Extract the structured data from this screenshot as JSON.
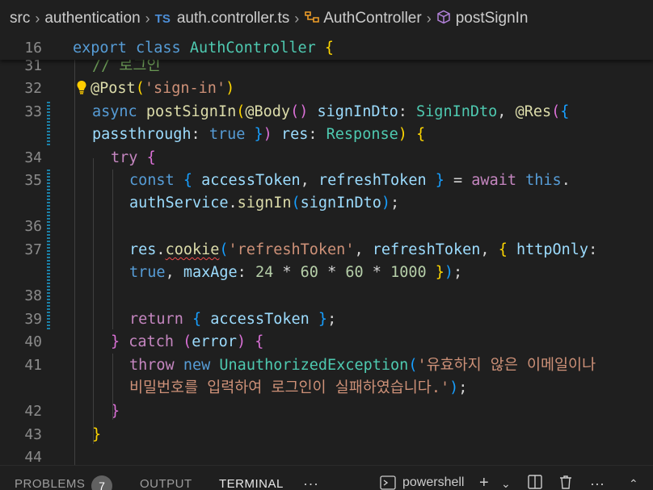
{
  "breadcrumb": {
    "items": [
      "src",
      "authentication",
      "auth.controller.ts",
      "AuthController",
      "postSignIn"
    ],
    "ts_badge": "TS"
  },
  "sticky": {
    "line_number": "16",
    "text": "export class AuthController {"
  },
  "lines": {
    "l31": {
      "num": "31",
      "text": "// 로그인"
    },
    "l32": {
      "num": "32",
      "text": "@Post('sign-in')"
    },
    "l33": {
      "num": "33",
      "text": "async postSignIn(@Body() signInDto: SignInDto, @Res({ passthrough: true }) res: Response) {"
    },
    "l34": {
      "num": "34",
      "text": "try {"
    },
    "l35": {
      "num": "35",
      "text": "const { accessToken, refreshToken } = await this.authService.signIn(signInDto);"
    },
    "l36": {
      "num": "36",
      "text": ""
    },
    "l37": {
      "num": "37",
      "text": "res.cookie('refreshToken', refreshToken, { httpOnly: true, maxAge: 24 * 60 * 60 * 1000 });"
    },
    "l38": {
      "num": "38",
      "text": ""
    },
    "l39": {
      "num": "39",
      "text": "return { accessToken };"
    },
    "l40": {
      "num": "40",
      "text": "} catch (error) {"
    },
    "l41": {
      "num": "41",
      "text": "throw new UnauthorizedException('유효하지 않은 이메일이나 비밀번호를 입력하여 로그인이 실패하였습니다.');"
    },
    "l42": {
      "num": "42",
      "text": "}"
    },
    "l43": {
      "num": "43",
      "text": "}"
    },
    "l44": {
      "num": "44",
      "text": ""
    }
  },
  "panel": {
    "tabs": [
      "PROBLEMS",
      "OUTPUT",
      "TERMINAL"
    ],
    "active_tab": "TERMINAL",
    "problems_count": "7",
    "more": "···",
    "terminal_name": "powershell",
    "icons": [
      "terminal-icon",
      "plus-icon",
      "chevron-down-icon",
      "split-icon",
      "trash-icon",
      "more-icon"
    ]
  },
  "colors": {
    "background": "#1f1f1f",
    "keyword": "#569cd6",
    "control": "#c586c0",
    "type": "#4ec9b0",
    "function": "#dcdcaa",
    "variable": "#9cdcfe",
    "string": "#ce9178",
    "number": "#b5cea8",
    "comment": "#6a9955",
    "bracket_1": "#ffd700",
    "bracket_2": "#da70d6",
    "bracket_3": "#179fff"
  }
}
